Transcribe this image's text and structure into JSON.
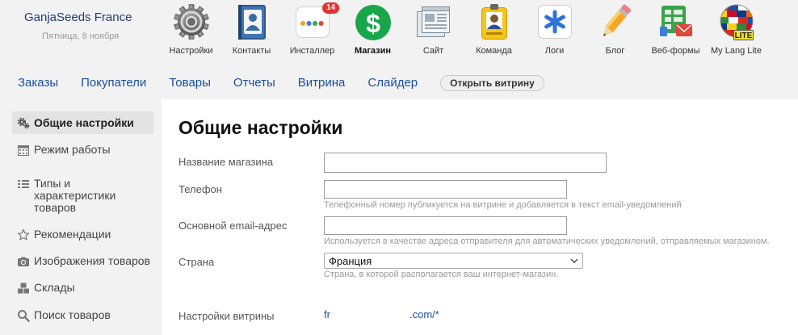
{
  "colors": {
    "accent": "#1b4f9e",
    "brand": "#203d78",
    "shop_green": "#19a64a",
    "badge_red": "#e2332f",
    "selected_bg": "#e3e3e3"
  },
  "brand": {
    "name": "GanjaSeeds France",
    "date": "Пятница, 8 ноября"
  },
  "apps": [
    {
      "label": "Настройки",
      "icon": "gear-icon"
    },
    {
      "label": "Контакты",
      "icon": "contacts-book-icon"
    },
    {
      "label": "Инсталлер",
      "icon": "installer-icon",
      "badge": "14"
    },
    {
      "label": "Магазин",
      "icon": "shop-dollar-icon",
      "glyph": "$",
      "active": true
    },
    {
      "label": "Сайт",
      "icon": "site-windows-icon"
    },
    {
      "label": "Команда",
      "icon": "team-badge-icon"
    },
    {
      "label": "Логи",
      "icon": "logs-asterisk-icon"
    },
    {
      "label": "Блог",
      "icon": "pencil-icon"
    },
    {
      "label": "Веб-формы",
      "icon": "web-forms-icon"
    },
    {
      "label": "My Lang Lite",
      "icon": "globe-flags-icon",
      "glyph": "LITE"
    }
  ],
  "nav": {
    "items": [
      "Заказы",
      "Покупатели",
      "Товары",
      "Отчеты",
      "Витрина",
      "Слайдер"
    ],
    "open_storefront": "Открыть витрину"
  },
  "sidebar": {
    "items": [
      {
        "label": "Общие настройки",
        "icon": "gears-icon",
        "selected": true
      },
      {
        "label": "Режим работы",
        "icon": "calendar-icon"
      },
      {
        "label": "Типы и характеристики товаров",
        "icon": "list-icon"
      },
      {
        "label": "Рекомендации",
        "icon": "star-icon"
      },
      {
        "label": "Изображения товаров",
        "icon": "camera-icon"
      },
      {
        "label": "Склады",
        "icon": "boxes-icon"
      },
      {
        "label": "Поиск товаров",
        "icon": "search-icon"
      }
    ]
  },
  "main": {
    "title": "Общие настройки",
    "fields": {
      "name": {
        "label": "Название магазина",
        "value": ""
      },
      "phone": {
        "label": "Телефон",
        "value": "",
        "hint": "Телефонный номер публикуется на витрине и добавляется в текст email-уведомлений"
      },
      "email": {
        "label": "Основной email-адрес",
        "value": "",
        "hint": "Используется в качестве адреса отправителя для автоматических уведомлений, отправляемых магазином."
      },
      "country": {
        "label": "Страна",
        "selected": "Франция",
        "hint": "Страна, в которой располагается ваш интернет-магазин."
      },
      "storefront": {
        "label": "Настройки витрины",
        "link_start": "fr",
        "link_end": ".com/*"
      }
    }
  }
}
